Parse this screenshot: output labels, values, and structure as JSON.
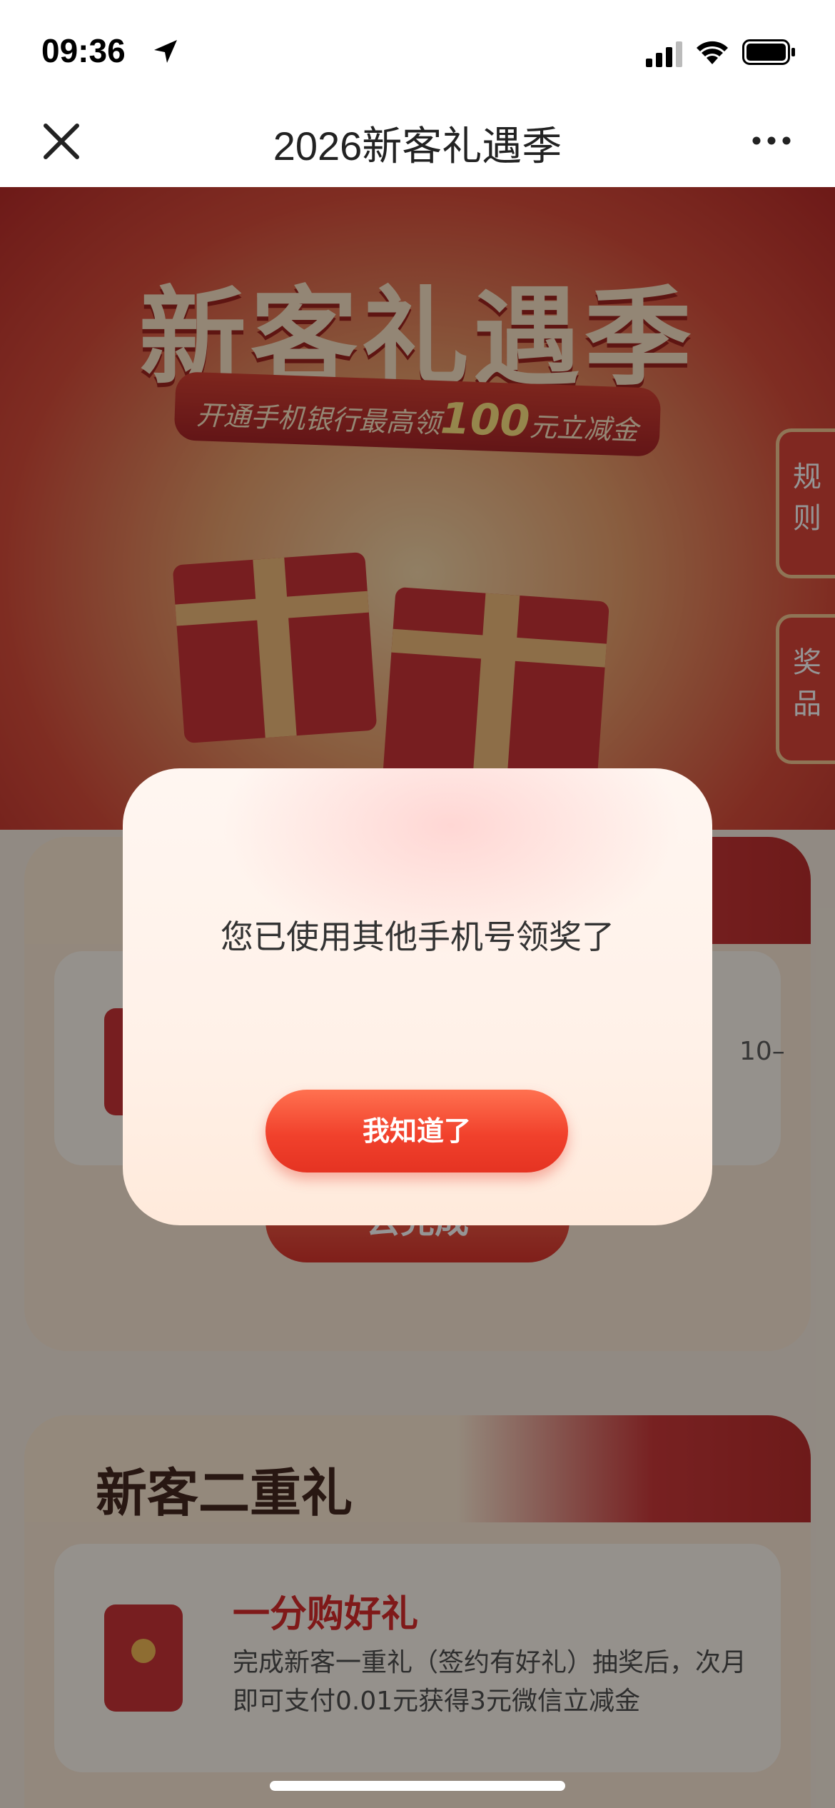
{
  "status_bar": {
    "time": "09:36"
  },
  "nav": {
    "title": "2026新客礼遇季"
  },
  "hero": {
    "title": "新客礼遇季",
    "ribbon_prefix": "开通手机银行最高领",
    "ribbon_amount": "100",
    "ribbon_suffix": "元立减金"
  },
  "side_tabs": {
    "rules": "规则",
    "prizes": "奖品"
  },
  "section1": {
    "partial_text": "10–",
    "button": "去完成"
  },
  "section2": {
    "title": "新客二重礼",
    "card_title": "一分购好礼",
    "card_desc": "完成新客一重礼（签约有好礼）抽奖后，次月即可支付0.01元获得3元微信立减金"
  },
  "dialog": {
    "message": "您已使用其他手机号领奖了",
    "button": "我知道了"
  },
  "colors": {
    "accent": "#f1412c",
    "brand_red": "#c9272a"
  }
}
